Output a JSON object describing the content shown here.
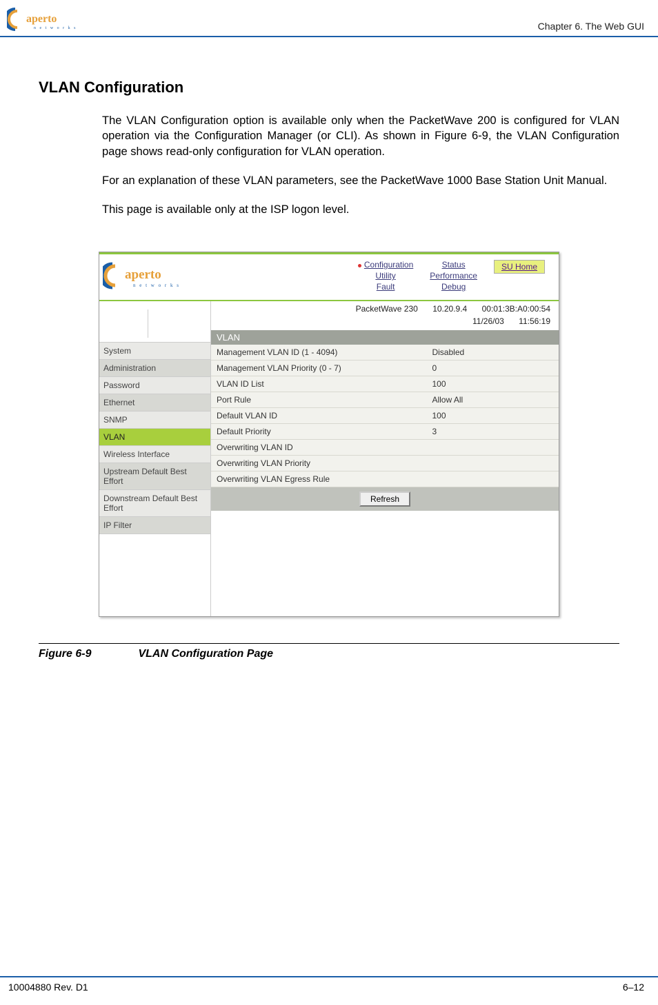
{
  "header": {
    "chapter": "Chapter 6.  The Web GUI"
  },
  "section": {
    "title": "VLAN Configuration",
    "para1": "The VLAN Configuration option is available only when the PacketWave 200 is configured for VLAN operation via the Configuration Manager (or CLI). As shown in Figure 6-9, the VLAN Configuration page shows read-only configuration for VLAN operation.",
    "para2": "For an explanation of these VLAN parameters, see the PacketWave 1000 Base Station Unit Manual.",
    "para3": "This page is available only at the ISP logon level."
  },
  "screenshot": {
    "nav": {
      "col1": [
        "Configuration",
        "Utility",
        "Fault"
      ],
      "col2": [
        "Status",
        "Performance",
        "Debug"
      ],
      "su_home": "SU Home"
    },
    "meta": {
      "device": "PacketWave 230",
      "ip": "10.20.9.4",
      "mac": "00:01:3B:A0:00:54",
      "date": "11/26/03",
      "time": "11:56:19"
    },
    "sidebar": [
      {
        "label": "System",
        "alt": false,
        "active": false
      },
      {
        "label": "Administration",
        "alt": true,
        "active": false
      },
      {
        "label": "Password",
        "alt": false,
        "active": false
      },
      {
        "label": "Ethernet",
        "alt": true,
        "active": false
      },
      {
        "label": "SNMP",
        "alt": false,
        "active": false
      },
      {
        "label": "VLAN",
        "alt": false,
        "active": true
      },
      {
        "label": "Wireless Interface",
        "alt": false,
        "active": false
      },
      {
        "label": "Upstream Default Best Effort",
        "alt": true,
        "active": false
      },
      {
        "label": "Downstream Default Best Effort",
        "alt": false,
        "active": false
      },
      {
        "label": "IP Filter",
        "alt": true,
        "active": false
      }
    ],
    "panel_title": "VLAN",
    "rows": [
      {
        "label": "Management VLAN ID (1 - 4094)",
        "value": "Disabled"
      },
      {
        "label": "Management VLAN Priority (0 - 7)",
        "value": "0"
      },
      {
        "label": "VLAN ID List",
        "value": "100"
      },
      {
        "label": "Port Rule",
        "value": "Allow All"
      },
      {
        "label": "Default VLAN ID",
        "value": "100"
      },
      {
        "label": "Default Priority",
        "value": "3"
      },
      {
        "label": "Overwriting VLAN ID",
        "value": ""
      },
      {
        "label": "Overwriting VLAN Priority",
        "value": ""
      },
      {
        "label": "Overwriting VLAN Egress Rule",
        "value": ""
      }
    ],
    "refresh": "Refresh"
  },
  "figure": {
    "num": "Figure 6-9",
    "title": "VLAN Configuration Page"
  },
  "footer": {
    "left": "10004880 Rev. D1",
    "right": "6–12"
  }
}
